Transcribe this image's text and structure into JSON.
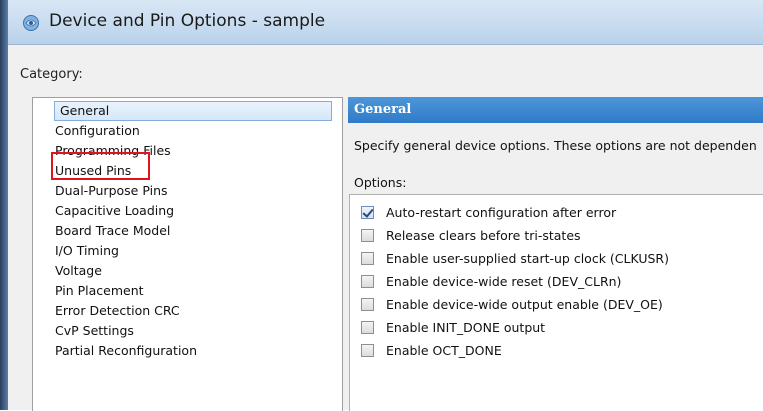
{
  "window": {
    "title": "Device and Pin Options - sample",
    "icon": "quartus-app-icon"
  },
  "category": {
    "label": "Category:",
    "items": [
      {
        "label": "General",
        "selected": true
      },
      {
        "label": "Configuration"
      },
      {
        "label": "Programming Files"
      },
      {
        "label": "Unused Pins",
        "highlighted": true
      },
      {
        "label": "Dual-Purpose Pins"
      },
      {
        "label": "Capacitive Loading"
      },
      {
        "label": "Board Trace Model"
      },
      {
        "label": "I/O Timing"
      },
      {
        "label": "Voltage"
      },
      {
        "label": "Pin Placement"
      },
      {
        "label": "Error Detection CRC"
      },
      {
        "label": "CvP Settings"
      },
      {
        "label": "Partial Reconfiguration"
      }
    ],
    "highlight_color": "#e0141a"
  },
  "panel": {
    "title": "General",
    "description": "Specify general device options. These options are not dependen",
    "options_label": "Options:",
    "options": [
      {
        "label": "Auto-restart configuration after error",
        "checked": true
      },
      {
        "label": "Release clears before tri-states",
        "checked": false
      },
      {
        "label": "Enable user-supplied start-up clock (CLKUSR)",
        "checked": false
      },
      {
        "label": "Enable device-wide reset (DEV_CLRn)",
        "checked": false
      },
      {
        "label": "Enable device-wide output enable (DEV_OE)",
        "checked": false
      },
      {
        "label": "Enable INIT_DONE output",
        "checked": false
      },
      {
        "label": "Enable OCT_DONE",
        "checked": false
      }
    ],
    "header_color": "#3a86cf"
  }
}
